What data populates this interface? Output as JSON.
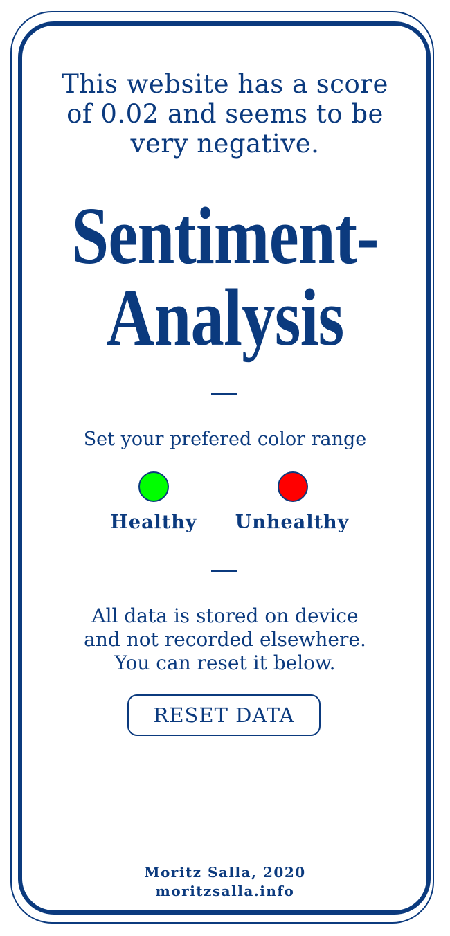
{
  "score": {
    "lines": [
      "This website has a score",
      "of 0.02 and seems to be",
      "very negative."
    ],
    "value": "0.02"
  },
  "title": {
    "line1": "Sentiment-",
    "line2": "Analysis"
  },
  "color_range": {
    "label": "Set your prefered color range",
    "healthy": {
      "label": "Healthy",
      "color": "#00ff00"
    },
    "unhealthy": {
      "label": "Unhealthy",
      "color": "#ff0000"
    }
  },
  "privacy": {
    "lines": [
      "All data is stored on device",
      "and not recorded elsewhere.",
      "You can reset it below."
    ]
  },
  "reset_button": {
    "label": "RESET DATA"
  },
  "footer": {
    "credit": "Moritz Salla, 2020",
    "link": "moritzsalla.info"
  },
  "colors": {
    "accent": "#0b3a7e",
    "background": "#ffffff"
  }
}
